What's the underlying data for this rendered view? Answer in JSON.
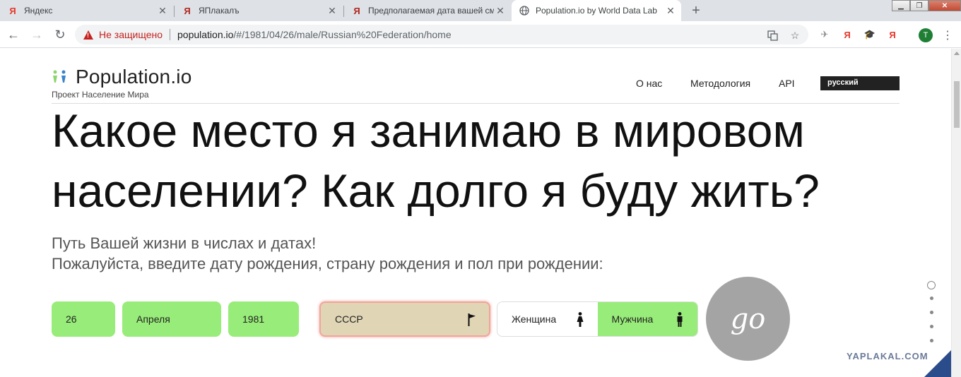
{
  "browser": {
    "tabs": [
      {
        "title": "Яндекс",
        "favicon": "Я",
        "favicon_color": "#e8382b",
        "active": false
      },
      {
        "title": "ЯПлакалъ",
        "favicon": "Я",
        "favicon_color": "#b3261e",
        "active": false
      },
      {
        "title": "Предполагаемая дата вашей см",
        "favicon": "Я",
        "favicon_color": "#b3261e",
        "active": false
      },
      {
        "title": "Population.io by World Data Lab",
        "favicon": "globe",
        "favicon_color": "#5f6368",
        "active": true
      }
    ],
    "new_tab_label": "+",
    "address": {
      "security_text": "Не защищено",
      "host": "population.io",
      "path": "/#/1981/04/26/male/Russian%20Federation/home"
    },
    "extensions": [
      "puzzle-icon",
      "yandex-icon",
      "hat-icon",
      "yandex-icon"
    ],
    "profile_initial": "T"
  },
  "site": {
    "logo_text": "Population.io",
    "tagline": "Проект Население Мира",
    "nav": [
      "О нас",
      "Методология",
      "API"
    ],
    "language": "русский",
    "headline_line1": "Какое место я занимаю в мировом",
    "headline_line2": "населении? Как долго я буду жить?",
    "subtitle_line1": "Путь Вашей жизни в числах и датах!",
    "subtitle_line2": "Пожалуйста, введите дату рождения, страну рождения и пол при рождении:",
    "form": {
      "day": "26",
      "month": "Апреля",
      "year": "1981",
      "country": "СССР",
      "gender_female": "Женщина",
      "gender_male": "Мужчина",
      "selected_gender": "male",
      "go_label": "go"
    },
    "section_dots": 5,
    "watermark": "YAPLAKAL.COM"
  },
  "colors": {
    "field_green": "#98ec79",
    "country_bg": "#e0d5b5",
    "go_gray": "#a4a4a4",
    "accent_blue": "#2b4c8a"
  }
}
